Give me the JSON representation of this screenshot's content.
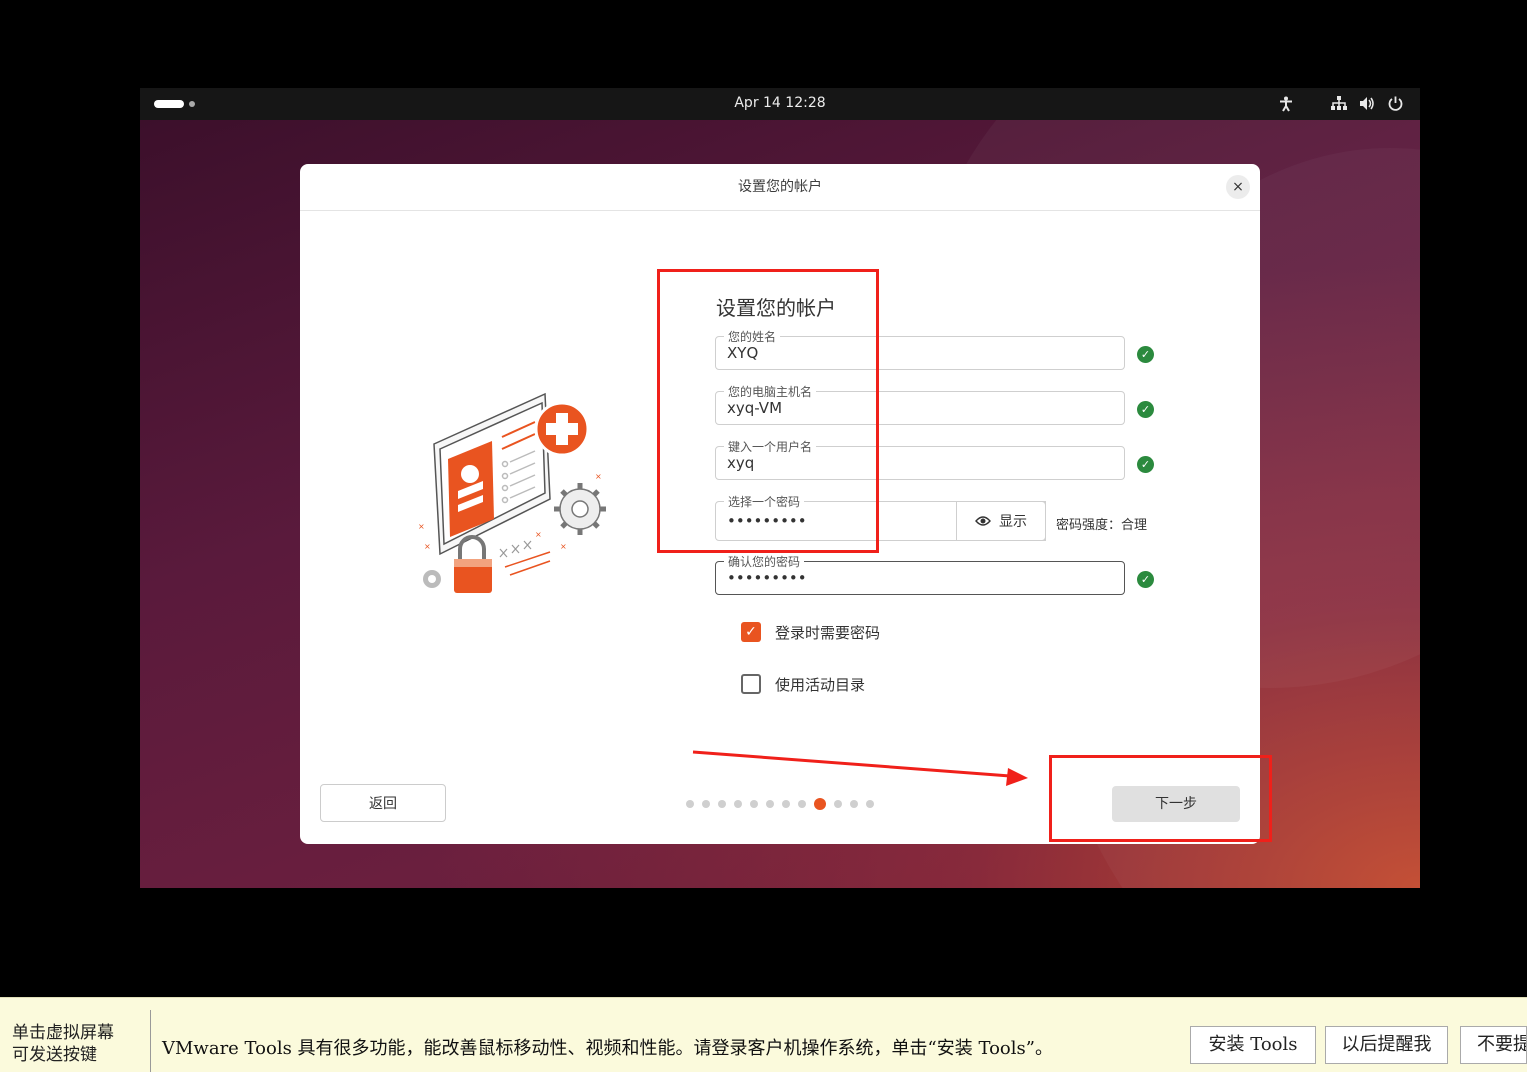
{
  "topbar": {
    "clock": "Apr 14  12:28"
  },
  "dialog": {
    "title": "设置您的帐户",
    "close_glyph": "×",
    "form_title": "设置您的帐户",
    "fields": [
      {
        "label": "您的姓名",
        "value": "XYQ"
      },
      {
        "label": "您的电脑主机名",
        "value": "xyq-VM"
      },
      {
        "label": "键入一个用户名",
        "value": "xyq"
      }
    ],
    "password": {
      "label": "选择一个密码",
      "value": "•••••••••",
      "show_label": "显示",
      "strength": "密码强度：合理"
    },
    "confirm": {
      "label": "确认您的密码",
      "value": "•••••••••"
    },
    "options": [
      {
        "label": "登录时需要密码",
        "checked": true
      },
      {
        "label": "使用活动目录",
        "checked": false
      }
    ],
    "back_label": "返回",
    "next_label": "下一步",
    "steps_total": 12,
    "steps_current": 9
  },
  "vmware_bar": {
    "hint": "单击虚拟屏幕\n可发送按键",
    "message": "VMware Tools 具有很多功能，能改善鼠标移动性、视频和性能。请登录客户机操作系统，单击“安装 Tools”。",
    "install_label": "安装 Tools",
    "remind_label": "以后提醒我",
    "never_label": "不要提醒"
  },
  "colors": {
    "accent": "#e95420",
    "annotation": "#f0201a",
    "valid": "#2b8a3e"
  }
}
